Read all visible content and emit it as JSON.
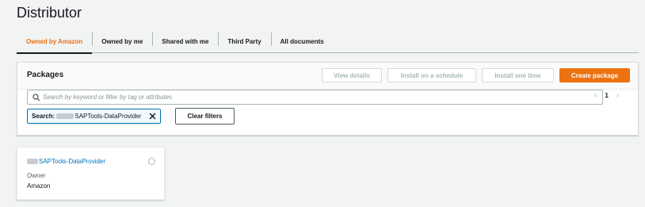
{
  "page": {
    "title": "Distributor"
  },
  "tabs": [
    {
      "label": "Owned by Amazon",
      "active": true
    },
    {
      "label": "Owned by me"
    },
    {
      "label": "Shared with me"
    },
    {
      "label": "Third Party"
    },
    {
      "label": "All documents"
    }
  ],
  "packages": {
    "title": "Packages",
    "buttons": {
      "view_details": "View details",
      "install_schedule": "Install on a schedule",
      "install_one_time": "Install one time",
      "create_package": "Create package"
    },
    "search": {
      "placeholder": "Search by keyword or filter by tag or attributes",
      "icon": "search-icon"
    },
    "pagination": {
      "current_page": "1",
      "prev_icon": "chevron-left-icon",
      "next_icon": "chevron-right-icon"
    },
    "filter_token": {
      "label": "Search:",
      "value": "SAPTools-DataProvider"
    },
    "clear_filters": "Clear filters"
  },
  "cards": [
    {
      "name": "SAPTools-DataProvider",
      "owner_label": "Owner",
      "owner": "Amazon"
    }
  ],
  "colors": {
    "accent": "#ec7211",
    "link": "#0073bb",
    "text": "#16191f"
  }
}
